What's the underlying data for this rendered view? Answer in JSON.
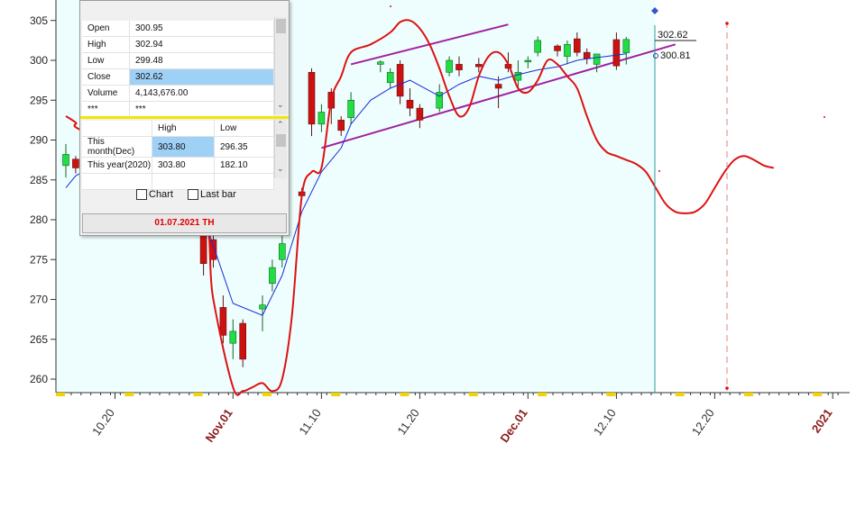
{
  "chart_data": {
    "type": "candlestick",
    "ylim": [
      258,
      305
    ],
    "y_ticks": [
      260,
      265,
      270,
      275,
      280,
      285,
      290,
      295,
      300,
      305
    ],
    "x_ticks": [
      {
        "label": "10.20",
        "day": 5,
        "month": false
      },
      {
        "label": "Nov.01",
        "day": 17,
        "month": true
      },
      {
        "label": "11.10",
        "day": 26,
        "month": false
      },
      {
        "label": "11.20",
        "day": 36,
        "month": false
      },
      {
        "label": "Dec.01",
        "day": 47,
        "month": true
      },
      {
        "label": "12.10",
        "day": 56,
        "month": false
      },
      {
        "label": "12.20",
        "day": 66,
        "month": false
      },
      {
        "label": "2021",
        "day": 78,
        "month": true
      }
    ],
    "candles": [
      {
        "d": 0,
        "o": 286.8,
        "h": 289.5,
        "l": 285.3,
        "c": 288.2
      },
      {
        "d": 1,
        "o": 287.6,
        "h": 288.0,
        "l": 285.8,
        "c": 286.5
      },
      {
        "d": 14,
        "o": 278.5,
        "h": 280.0,
        "l": 273.0,
        "c": 274.5
      },
      {
        "d": 15,
        "o": 277.5,
        "h": 279.0,
        "l": 274.0,
        "c": 275.0
      },
      {
        "d": 16,
        "o": 269.0,
        "h": 270.5,
        "l": 264.5,
        "c": 265.5
      },
      {
        "d": 17,
        "o": 264.5,
        "h": 267.5,
        "l": 262.5,
        "c": 266.0
      },
      {
        "d": 18,
        "o": 267.0,
        "h": 267.5,
        "l": 261.5,
        "c": 262.5
      },
      {
        "d": 20,
        "o": 268.8,
        "h": 270.5,
        "l": 266.0,
        "c": 269.3
      },
      {
        "d": 21,
        "o": 272.0,
        "h": 275.0,
        "l": 271.0,
        "c": 274.0
      },
      {
        "d": 22,
        "o": 275.0,
        "h": 279.0,
        "l": 274.0,
        "c": 277.0
      },
      {
        "d": 24,
        "o": 283.5,
        "h": 284.0,
        "l": 282.5,
        "c": 283.0
      },
      {
        "d": 25,
        "o": 298.5,
        "h": 299.0,
        "l": 290.5,
        "c": 292.0
      },
      {
        "d": 26,
        "o": 292.0,
        "h": 294.5,
        "l": 291.0,
        "c": 293.5
      },
      {
        "d": 27,
        "o": 296.0,
        "h": 296.5,
        "l": 292.0,
        "c": 294.0
      },
      {
        "d": 28,
        "o": 292.5,
        "h": 293.0,
        "l": 290.5,
        "c": 291.2
      },
      {
        "d": 29,
        "o": 292.8,
        "h": 296.0,
        "l": 292.0,
        "c": 295.0
      },
      {
        "d": 32,
        "o": 299.5,
        "h": 300.0,
        "l": 298.5,
        "c": 299.8
      },
      {
        "d": 33,
        "o": 297.2,
        "h": 299.0,
        "l": 296.5,
        "c": 298.5
      },
      {
        "d": 34,
        "o": 299.5,
        "h": 300.0,
        "l": 294.5,
        "c": 295.5
      },
      {
        "d": 35,
        "o": 295.0,
        "h": 296.5,
        "l": 293.0,
        "c": 294.0
      },
      {
        "d": 36,
        "o": 294.0,
        "h": 294.5,
        "l": 291.5,
        "c": 292.5
      },
      {
        "d": 38,
        "o": 294.0,
        "h": 297.0,
        "l": 293.5,
        "c": 296.0
      },
      {
        "d": 39,
        "o": 298.5,
        "h": 300.5,
        "l": 298.0,
        "c": 300.0
      },
      {
        "d": 40,
        "o": 299.5,
        "h": 300.5,
        "l": 298.0,
        "c": 298.8
      },
      {
        "d": 42,
        "o": 299.5,
        "h": 300.3,
        "l": 298.5,
        "c": 299.2
      },
      {
        "d": 44,
        "o": 297.0,
        "h": 298.0,
        "l": 294.0,
        "c": 296.5
      },
      {
        "d": 45,
        "o": 299.5,
        "h": 301.0,
        "l": 298.5,
        "c": 299.0
      },
      {
        "d": 46,
        "o": 297.5,
        "h": 300.0,
        "l": 296.5,
        "c": 298.5
      },
      {
        "d": 47,
        "o": 299.8,
        "h": 300.5,
        "l": 299.0,
        "c": 300.0
      },
      {
        "d": 48,
        "o": 301.0,
        "h": 303.0,
        "l": 300.5,
        "c": 302.5
      },
      {
        "d": 50,
        "o": 301.8,
        "h": 302.0,
        "l": 300.5,
        "c": 301.2
      },
      {
        "d": 51,
        "o": 300.5,
        "h": 302.5,
        "l": 299.5,
        "c": 302.0
      },
      {
        "d": 52,
        "o": 302.7,
        "h": 303.5,
        "l": 300.5,
        "c": 301.0
      },
      {
        "d": 53,
        "o": 301.0,
        "h": 301.5,
        "l": 299.5,
        "c": 300.2
      },
      {
        "d": 54,
        "o": 299.5,
        "h": 300.5,
        "l": 298.5,
        "c": 300.8
      },
      {
        "d": 56,
        "o": 302.6,
        "h": 303.5,
        "l": 298.8,
        "c": 299.3
      },
      {
        "d": 57,
        "o": 300.95,
        "h": 302.94,
        "l": 299.48,
        "c": 302.62
      }
    ],
    "ma": [
      [
        0,
        284.0
      ],
      [
        1,
        285.5
      ],
      [
        2,
        286.2
      ],
      [
        13,
        284.0
      ],
      [
        17,
        269.5
      ],
      [
        20,
        268.0
      ],
      [
        22,
        273.0
      ],
      [
        24,
        281.0
      ],
      [
        26,
        286.0
      ],
      [
        28,
        289.0
      ],
      [
        29,
        292.0
      ],
      [
        31,
        295.0
      ],
      [
        33,
        296.5
      ],
      [
        35,
        297.5
      ],
      [
        38,
        295.5
      ],
      [
        40,
        297.0
      ],
      [
        42,
        298.0
      ],
      [
        44,
        297.5
      ],
      [
        46,
        298.2
      ],
      [
        48,
        298.8
      ],
      [
        50,
        299.2
      ],
      [
        52,
        300.0
      ],
      [
        53,
        300.2
      ],
      [
        55,
        300.5
      ],
      [
        57,
        300.81
      ]
    ],
    "projection": [
      [
        0,
        293.0
      ],
      [
        1,
        292.2
      ],
      [
        2,
        291.0
      ],
      [
        13,
        286.0
      ],
      [
        15,
        270.0
      ],
      [
        17,
        259.0
      ],
      [
        18,
        258.5
      ],
      [
        19,
        259.0
      ],
      [
        20,
        259.5
      ],
      [
        21,
        258.5
      ],
      [
        22,
        260.0
      ],
      [
        23,
        268.0
      ],
      [
        24,
        283.0
      ],
      [
        25,
        286.0
      ],
      [
        26,
        286.5
      ],
      [
        27,
        295.0
      ],
      [
        28,
        298.0
      ],
      [
        29,
        301.0
      ],
      [
        31,
        302.0
      ],
      [
        33,
        303.5
      ],
      [
        34,
        304.8
      ],
      [
        35,
        305.0
      ],
      [
        36,
        304.0
      ],
      [
        37,
        302.0
      ],
      [
        38,
        299.0
      ],
      [
        39,
        295.5
      ],
      [
        40,
        293.0
      ],
      [
        41,
        294.0
      ],
      [
        42,
        298.0
      ],
      [
        43,
        300.5
      ],
      [
        44,
        301.0
      ],
      [
        45,
        299.5
      ],
      [
        46,
        296.5
      ],
      [
        47,
        296.0
      ],
      [
        48,
        297.5
      ],
      [
        49,
        300.0
      ],
      [
        50,
        299.5
      ],
      [
        51,
        298.0
      ],
      [
        52,
        296.5
      ],
      [
        53,
        293.0
      ],
      [
        54,
        290.0
      ],
      [
        55,
        288.5
      ],
      [
        56,
        288.0
      ],
      [
        57,
        287.5
      ],
      [
        58,
        287.0
      ],
      [
        59,
        286.0
      ],
      [
        60,
        284.0
      ],
      [
        61,
        282.0
      ],
      [
        62,
        281.0
      ],
      [
        63,
        280.8
      ],
      [
        64,
        281.0
      ],
      [
        65,
        282.0
      ],
      [
        66,
        284.0
      ],
      [
        67,
        286.0
      ],
      [
        68,
        287.5
      ],
      [
        69,
        288.0
      ],
      [
        70,
        287.5
      ],
      [
        71,
        286.8
      ],
      [
        72,
        286.5
      ]
    ],
    "channel_upper": [
      [
        29,
        299.5
      ],
      [
        45,
        304.5
      ]
    ],
    "channel_lower": [
      [
        26,
        289.0
      ],
      [
        62,
        302.0
      ]
    ],
    "current_price_label": "302.62",
    "ma_label": "300.81"
  },
  "info_panel": {
    "ohlc": [
      {
        "label": "Open",
        "value": "300.95"
      },
      {
        "label": "High",
        "value": "302.94"
      },
      {
        "label": "Low",
        "value": "299.48"
      },
      {
        "label": "Close",
        "value": "302.62"
      },
      {
        "label": "Volume",
        "value": "4,143,676.00"
      },
      {
        "label": "***",
        "value": "***"
      }
    ],
    "range_header": {
      "high": "High",
      "low": "Low"
    },
    "ranges": [
      {
        "label": "This month(Dec)",
        "high": "303.80",
        "low": "296.35"
      },
      {
        "label": "This year(2020)",
        "high": "303.80",
        "low": "182.10"
      }
    ],
    "chart_option": "Chart",
    "lastbar_option": "Last bar",
    "date": "01.07.2021 TH"
  },
  "colors": {
    "up": "#22dd44",
    "down": "#cc1111",
    "projection": "#dd1111",
    "ma": "#1a2bd8",
    "channel": "#a020a0",
    "background": "#eefefe",
    "highlight": "#9fd0f6"
  }
}
